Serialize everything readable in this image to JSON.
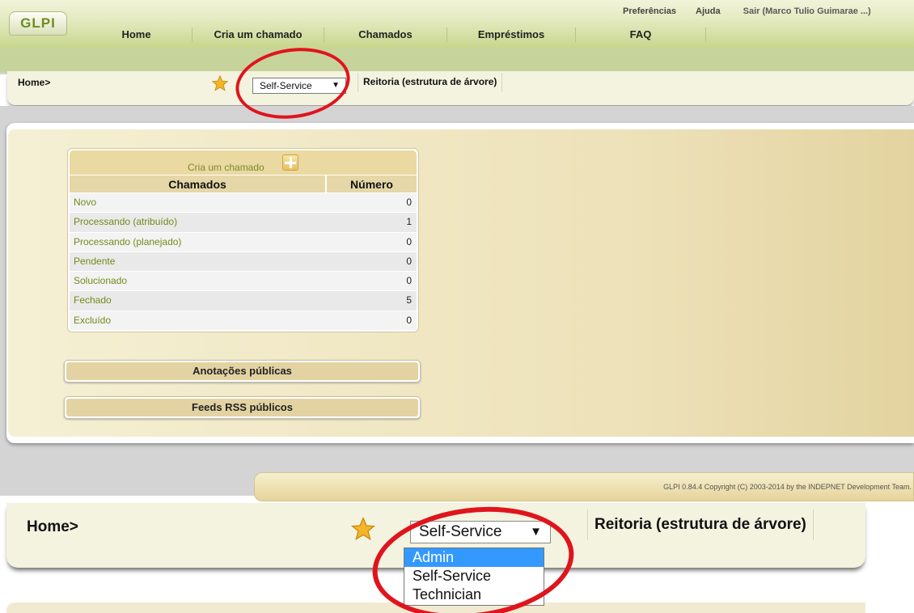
{
  "header": {
    "logo": "GLPI",
    "menu": [
      "Home",
      "Cria um chamado",
      "Chamados",
      "Empréstimos",
      "FAQ"
    ],
    "preferences": "Preferências",
    "help": "Ajuda",
    "logout": "Sair (Marco Tulio Guimarae ...)"
  },
  "breadcrumb": {
    "home": "Home>",
    "profile_select": "Self-Service",
    "entity": "Reitoria (estrutura de árvore)"
  },
  "tickets": {
    "create_link": "Cria um chamado",
    "header_tickets": "Chamados",
    "header_number": "Número",
    "rows": [
      {
        "label": "Novo",
        "value": "0"
      },
      {
        "label": "Processando (atribuído)",
        "value": "1"
      },
      {
        "label": "Processando (planejado)",
        "value": "0"
      },
      {
        "label": "Pendente",
        "value": "0"
      },
      {
        "label": "Solucionado",
        "value": "0"
      },
      {
        "label": "Fechado",
        "value": "5"
      },
      {
        "label": "Excluído",
        "value": "0"
      }
    ]
  },
  "sections": {
    "public_notes": "Anotações públicas",
    "public_rss": "Feeds RSS públicos"
  },
  "footer": "GLPI 0.84.4 Copyright (C) 2003-2014 by the INDEPNET Development Team.",
  "zoom": {
    "home": "Home>",
    "profile_select": "Self-Service",
    "entity": "Reitoria (estrutura de árvore)",
    "options": [
      "Admin",
      "Self-Service",
      "Technician"
    ],
    "selected_option": "Admin"
  },
  "colors": {
    "link_green": "#6f8b1a",
    "annotation_red": "#e0141c",
    "highlight_blue": "#3399ff"
  },
  "icons": [
    "star-icon",
    "add-icon",
    "dropdown-arrow-icon"
  ]
}
